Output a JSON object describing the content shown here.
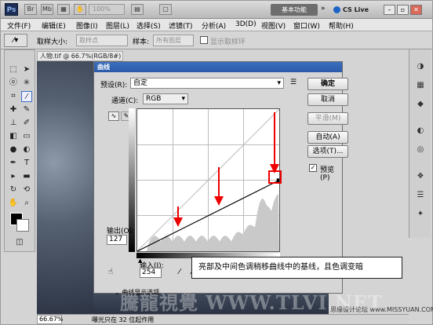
{
  "titlebar": {
    "logo": "Ps",
    "zoom": "100%",
    "workspace": "基本功能",
    "cslive": "CS Live"
  },
  "menu": [
    "文件(F)",
    "编辑(E)",
    "图像(I)",
    "图层(L)",
    "选择(S)",
    "滤镜(T)",
    "分析(A)",
    "3D(D)",
    "视图(V)",
    "窗口(W)",
    "帮助(H)"
  ],
  "options": {
    "size_label": "取样大小:",
    "size_value": "取样点",
    "sample_label": "样本:",
    "sample_value": "所有图层",
    "show_ring": "显示取样环"
  },
  "document": {
    "tab": "人物.tif @ 66.7%(RGB/8#) *"
  },
  "status": {
    "zoom": "66.67%",
    "text": "曝光只在 32 位起作用"
  },
  "dialog": {
    "title": "曲线",
    "preset_label": "预设(R):",
    "preset_value": "自定",
    "channel_label": "通道(C):",
    "channel_value": "RGB",
    "output_label": "输出(O):",
    "output_value": "127",
    "input_label": "输入(I):",
    "input_value": "254",
    "buttons": {
      "ok": "确定",
      "cancel": "取消",
      "smooth": "平滑(M)",
      "auto": "自动(A)",
      "options": "选项(T)..."
    },
    "preview_label": "预览(P)",
    "curve_display": "曲线显示选项"
  },
  "callout": "亮部及中间色调稍移曲线中的基线，且色调变暗",
  "watermark": "騰龍視覺 WWW.TLVI.NET",
  "forum": "思缘设计论坛 www.MISSYUAN.COM",
  "curve": {
    "control_input": 254,
    "control_output": 127
  }
}
